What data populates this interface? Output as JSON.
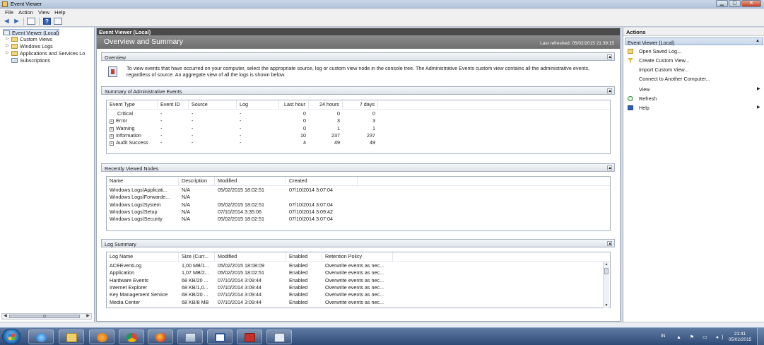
{
  "window": {
    "title": "Event Viewer"
  },
  "menu": [
    "File",
    "Action",
    "View",
    "Help"
  ],
  "tree": {
    "items": [
      {
        "label": "Event Viewer (Local)",
        "level": 0,
        "icon": "event-viewer-icon"
      },
      {
        "label": "Custom Views",
        "level": 1,
        "icon": "folder-icon"
      },
      {
        "label": "Windows Logs",
        "level": 1,
        "icon": "folder-icon"
      },
      {
        "label": "Applications and Services Lo",
        "level": 1,
        "icon": "folder-icon"
      },
      {
        "label": "Subscriptions",
        "level": 1,
        "icon": "subscriptions-icon"
      }
    ],
    "scroll_thumb": "III"
  },
  "center": {
    "header": "Event Viewer (Local)",
    "banner_title": "Overview and Summary",
    "last_refreshed": "Last refreshed: 05/02/2015 21:39:15"
  },
  "overview": {
    "title": "Overview",
    "text": "To view events that have occurred on your computer, select the appropriate source, log or custom view node in the console tree. The Administrative Events custom view contains all the administrative events, regardless of source. An aggregate view of all the logs is shown below."
  },
  "summary": {
    "title": "Summary of Administrative Events",
    "columns": [
      "Event Type",
      "Event ID",
      "Source",
      "Log",
      "Last hour",
      "24 hours",
      "7 days"
    ],
    "rows": [
      {
        "type": "Critical",
        "expand": false,
        "id": "-",
        "source": "-",
        "log": "-",
        "hour": "0",
        "day": "0",
        "week": "0"
      },
      {
        "type": "Error",
        "expand": true,
        "id": "-",
        "source": "-",
        "log": "-",
        "hour": "0",
        "day": "3",
        "week": "3"
      },
      {
        "type": "Warning",
        "expand": true,
        "id": "-",
        "source": "-",
        "log": "-",
        "hour": "0",
        "day": "1",
        "week": "1"
      },
      {
        "type": "Information",
        "expand": true,
        "id": "-",
        "source": "-",
        "log": "-",
        "hour": "10",
        "day": "237",
        "week": "237"
      },
      {
        "type": "Audit Success",
        "expand": true,
        "id": "-",
        "source": "-",
        "log": "-",
        "hour": "4",
        "day": "49",
        "week": "49"
      }
    ]
  },
  "recent": {
    "title": "Recently Viewed Nodes",
    "columns": [
      "Name",
      "Description",
      "Modified",
      "Created"
    ],
    "rows": [
      {
        "name": "Windows Logs\\Applicati...",
        "desc": "N/A",
        "modified": "05/02/2015 18:02:51",
        "created": "07/10/2014 3:07:04"
      },
      {
        "name": "Windows Logs\\Forwarde...",
        "desc": "N/A",
        "modified": "",
        "created": ""
      },
      {
        "name": "Windows Logs\\System",
        "desc": "N/A",
        "modified": "05/02/2015 18:02:51",
        "created": "07/10/2014 3:07:04"
      },
      {
        "name": "Windows Logs\\Setup",
        "desc": "N/A",
        "modified": "07/10/2014 3:35:06",
        "created": "07/10/2014 3:09:42"
      },
      {
        "name": "Windows Logs\\Security",
        "desc": "N/A",
        "modified": "05/02/2015 18:02:51",
        "created": "07/10/2014 3:07:04"
      }
    ]
  },
  "logsummary": {
    "title": "Log Summary",
    "columns": [
      "Log Name",
      "Size (Curr...",
      "Modified",
      "Enabled",
      "Retention Policy"
    ],
    "rows": [
      {
        "name": "ACEEventLog",
        "size": "1,00 MB/1...",
        "modified": "05/02/2015 18:08:09",
        "enabled": "Enabled",
        "policy": "Overwrite events as nec..."
      },
      {
        "name": "Application",
        "size": "1,07 MB/2...",
        "modified": "05/02/2015 18:02:51",
        "enabled": "Enabled",
        "policy": "Overwrite events as nec..."
      },
      {
        "name": "Hardware Events",
        "size": "68 KB/20 ...",
        "modified": "07/10/2014 3:09:44",
        "enabled": "Enabled",
        "policy": "Overwrite events as nec..."
      },
      {
        "name": "Internet Explorer",
        "size": "68 KB/1,0...",
        "modified": "07/10/2014 3:09:44",
        "enabled": "Enabled",
        "policy": "Overwrite events as nec..."
      },
      {
        "name": "Key Management Service",
        "size": "68 KB/20 ...",
        "modified": "07/10/2014 3:09:44",
        "enabled": "Enabled",
        "policy": "Overwrite events as nec..."
      },
      {
        "name": "Media Center",
        "size": "68 KB/8 MB",
        "modified": "07/10/2014 3:09:44",
        "enabled": "Enabled",
        "policy": "Overwrite events as nec..."
      }
    ]
  },
  "actions": {
    "title": "Actions",
    "section": "Event Viewer (Local)",
    "items": [
      {
        "label": "Open Saved Log...",
        "icon": "open-folder-icon",
        "submenu": false
      },
      {
        "label": "Create Custom View...",
        "icon": "filter-icon",
        "submenu": false
      },
      {
        "label": "Import Custom View...",
        "icon": "",
        "submenu": false
      },
      {
        "label": "Connect to Another Computer...",
        "icon": "",
        "submenu": false
      },
      {
        "label": "View",
        "icon": "",
        "submenu": true
      },
      {
        "label": "Refresh",
        "icon": "refresh-icon",
        "submenu": false
      },
      {
        "label": "Help",
        "icon": "help-icon",
        "submenu": true
      }
    ]
  },
  "taskbar": {
    "apps": [
      "internet-explorer-icon",
      "file-explorer-icon",
      "media-player-icon",
      "chrome-icon",
      "firefox-icon",
      "window-icon",
      "word-icon",
      "toolbox-icon",
      "event-viewer-icon"
    ],
    "lang": "IN",
    "time": "21:41",
    "date": "05/02/2015"
  }
}
